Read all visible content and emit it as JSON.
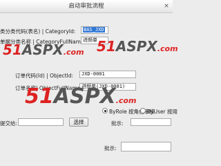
{
  "window": {
    "title": "启动审批流程",
    "close_glyph": "×"
  },
  "watermark": {
    "brand_num": "51",
    "brand_text": "ASPX",
    "suffix": ".com"
  },
  "form": {
    "category_id_label": "类分类代码(表名) | CategoryId:",
    "category_id_value": "BAS_JXD",
    "category_name_label": "单据分类名称 | CategoryFullName:",
    "category_name_value": "进频单",
    "object_id_label": "订单代码(Id) | ObjectId:",
    "object_id_value": "JXD-0001",
    "object_name_label": "订单名称| ObjectFullName:",
    "object_name_value": "进频单(JXD-0001)",
    "radio_byrole_label": "ByRole 按角色审核",
    "radio_byuser_label": "ByUser 按用",
    "submit_to_label": "提交给:",
    "submit_to_value": "",
    "select_button_label": "选择",
    "batch_note_label": "批示:",
    "batch_note_value": "",
    "batch_note2_label": "批示:",
    "batch_note2_value": ""
  }
}
